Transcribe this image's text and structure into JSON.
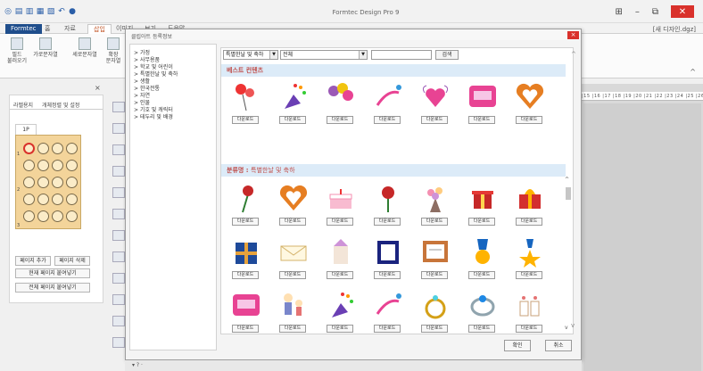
{
  "window": {
    "title": "Formtec Design Pro 9",
    "document_name": "[새 디자인.dgz]",
    "minimize_glyph": "–",
    "restore_glyph": "⧉",
    "close_glyph": "✕"
  },
  "tabs": [
    "Formtec",
    "홈",
    "자료",
    "삽입",
    "이미지",
    "보기",
    "도움말"
  ],
  "ribbon": {
    "items": [
      {
        "label": "필드\n불러오기"
      },
      {
        "label": "가로문자열"
      },
      {
        "label": "세로문자열"
      },
      {
        "label": "확장\n문자열"
      }
    ]
  },
  "left_panel": {
    "tab_labels": [
      "라벨용지",
      "개체정렬 및 설정"
    ],
    "page_tab": "1P",
    "row_numbers": [
      "1",
      "2",
      "3"
    ],
    "buttons": {
      "add_page": "페이지 추가",
      "delete_page": "페이지 삭제",
      "paste_current": "현재 페이지 붙여넣기",
      "paste_all": "전체 페이지 붙여넣기"
    }
  },
  "dialog": {
    "title": "클립아트 등록정보",
    "close_label": "×",
    "tree": [
      "가정",
      "사무용품",
      "학교 및 어린이",
      "특별한날 및 축하",
      "생활",
      "한국전통",
      "자연",
      "인물",
      "기호 및 캐릭터",
      "테두리 및 배경"
    ],
    "search": {
      "category_value": "특별한날 및 축하",
      "scope_value": "전체",
      "input_value": "",
      "button_label": "검색"
    },
    "best_section_title": "베스트 컨텐츠",
    "category_section_prefix": "분류명 :",
    "category_section_name": "특별한날 및 축하",
    "download_label": "다운로드",
    "best_items": [
      "balloons",
      "party-popper",
      "balloon-bunch",
      "party-blower",
      "winged-heart",
      "birthday-text",
      "heart-wreath"
    ],
    "gallery_items": [
      "rose-bouquet",
      "heart-wreath",
      "cake",
      "rose",
      "flower-bouquet",
      "gift-box",
      "gift-box-gold",
      "blue-gift-box",
      "envelope",
      "ribbon-gift-bag",
      "certificate-folder",
      "certificate-frame",
      "medal",
      "star-medal",
      "birthday-text",
      "couple-kids",
      "party-popper",
      "party-blower",
      "ring",
      "diamond-ring",
      "cups"
    ],
    "ok_label": "확인",
    "cancel_label": "취소"
  },
  "statusbar": {
    "text": "▾ ? ·"
  },
  "ruler_text": "|15 |16 |17 |18 |19 |20 |21 |22 |23 |24 |25 |26 |27",
  "colors": {
    "accent": "#1f4e8c",
    "close_red": "#d9312b",
    "section_bar": "#dcebf8",
    "section_text": "#c0504d",
    "label_paper": "#f3d49a"
  }
}
